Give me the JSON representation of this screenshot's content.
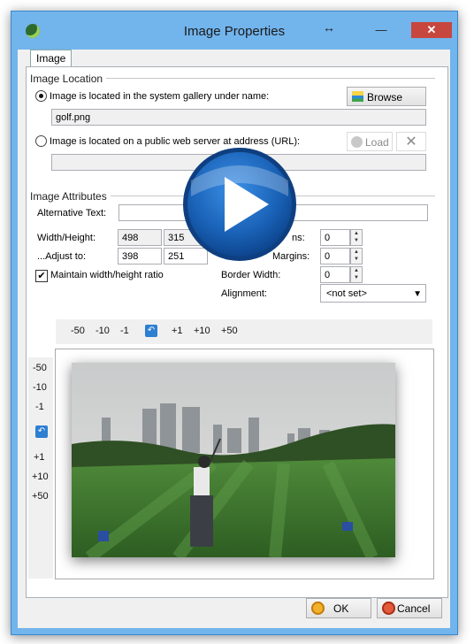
{
  "window": {
    "title": "Image Properties",
    "resize_glyph": "↔",
    "minimize": "—",
    "maximize": "☐",
    "close": "✕"
  },
  "tabs": [
    {
      "label": "Image"
    }
  ],
  "location": {
    "group_label": "Image Location",
    "option_gallery": {
      "label": "Image is located in the system gallery under name:",
      "selected": true
    },
    "gallery_name": "golf.png",
    "browse_label": "Browse",
    "option_url": {
      "label": "Image is located on a public web server at address (URL):",
      "selected": false
    },
    "load_label": "Load",
    "url_value": ""
  },
  "attributes": {
    "group_label": "Image Attributes",
    "alt_label": "Alternative Text:",
    "alt_value": "",
    "wh_label": "Width/Height:",
    "width": "498",
    "height": "315",
    "adjust_label": "...Adjust to:",
    "adjust_width": "398",
    "adjust_height": "251",
    "hmargins_label_partial": "ns:",
    "hmargins_value": "0",
    "vmargins_label_partial": "Margins:",
    "vmargins_value": "0",
    "border_label": "Border Width:",
    "border_value": "0",
    "alignment_label": "Alignment:",
    "alignment_value": "<not set>",
    "maintain_ratio_label": "Maintain width/height ratio",
    "maintain_ratio_checked": true
  },
  "width_steps": [
    "-50",
    "-10",
    "-1",
    "+1",
    "+10",
    "+50"
  ],
  "height_steps": [
    "-50",
    "-10",
    "-1",
    "+1",
    "+10",
    "+50"
  ],
  "footer": {
    "ok_label": "OK",
    "cancel_label": "Cancel"
  },
  "colors": {
    "title_bar": "#72b4ec",
    "close_button": "#c7463d",
    "play_overlay": "#1f6fc4"
  },
  "icons": [
    "app-icon",
    "browse-icon",
    "load-icon",
    "clear-icon",
    "reset-width-icon",
    "reset-height-icon",
    "ok-icon",
    "cancel-icon",
    "play-icon"
  ]
}
